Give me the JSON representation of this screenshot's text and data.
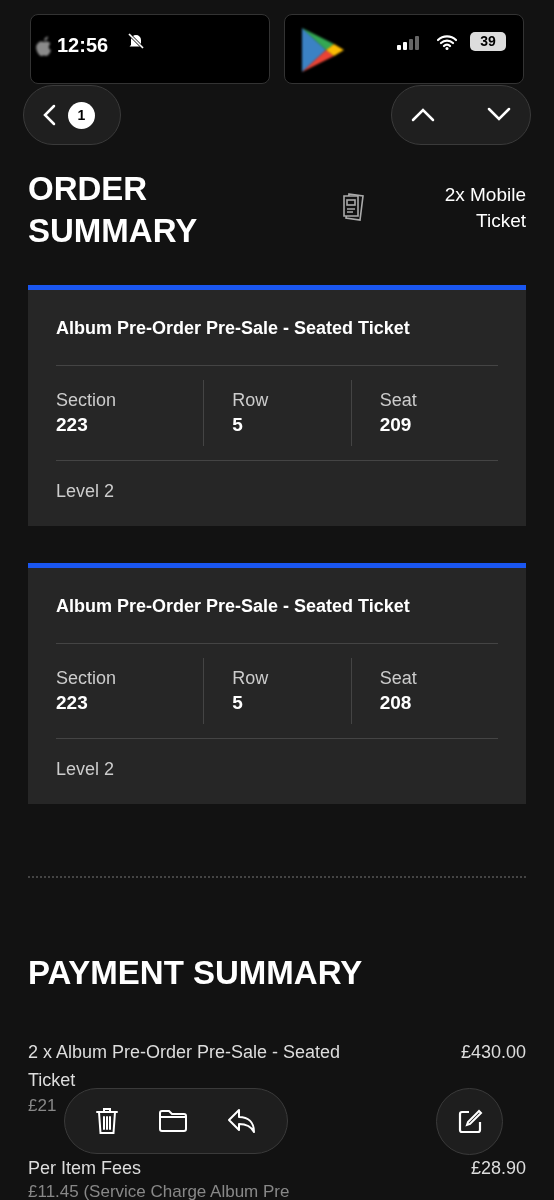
{
  "status_bar": {
    "time": "12:56",
    "battery": "39"
  },
  "nav": {
    "back_count": "1"
  },
  "order_summary": {
    "title": "ORDER SUMMARY",
    "ticket_type": "2x Mobile Ticket"
  },
  "tickets": [
    {
      "name": "Album Pre-Order Pre-Sale - Seated Ticket",
      "fields": [
        {
          "label": "Section",
          "value": "223"
        },
        {
          "label": "Row",
          "value": "5"
        },
        {
          "label": "Seat",
          "value": "209"
        }
      ],
      "level": "Level 2"
    },
    {
      "name": "Album Pre-Order Pre-Sale - Seated Ticket",
      "fields": [
        {
          "label": "Section",
          "value": "223"
        },
        {
          "label": "Row",
          "value": "5"
        },
        {
          "label": "Seat",
          "value": "208"
        }
      ],
      "level": "Level 2"
    }
  ],
  "payment_summary": {
    "title": "PAYMENT SUMMARY",
    "items": [
      {
        "description": "2 x Album Pre-Order Pre-Sale - Seated Ticket",
        "amount": "£430.00",
        "detail": "£21"
      },
      {
        "description": "Per Item Fees",
        "amount": "£28.90",
        "detail": "£11.45 (Service Charge Album Pre"
      }
    ]
  }
}
